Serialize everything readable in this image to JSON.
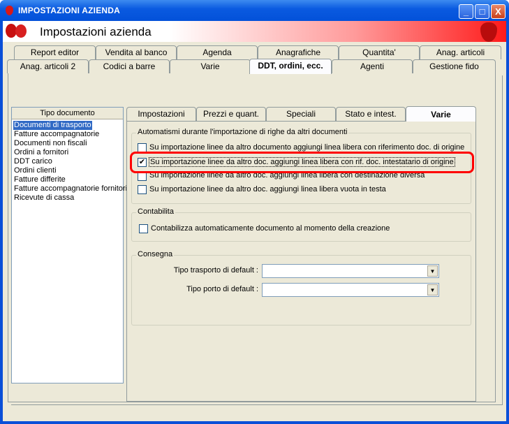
{
  "window": {
    "title": "IMPOSTAZIONI AZIENDA",
    "buttons": {
      "minimize": "_",
      "maximize": "□",
      "close": "X"
    }
  },
  "header": {
    "title": "Impostazioni azienda"
  },
  "outer_tabs": {
    "row1": [
      "Report editor",
      "Vendita al banco",
      "Agenda",
      "Anagrafiche",
      "Quantita'",
      "Anag. articoli"
    ],
    "row2": [
      "Anag. articoli 2",
      "Codici a barre",
      "Varie",
      "DDT, ordini, ecc.",
      "Agenti",
      "Gestione fido"
    ],
    "active": "DDT, ordini, ecc."
  },
  "doc_list": {
    "header": "Tipo documento",
    "items": [
      "Documenti di trasporto",
      "Fatture accompagnatorie",
      "Documenti non fiscali",
      "Ordini a fornitori",
      "DDT carico",
      "Ordini clienti",
      "Fatture differite",
      "Fatture accompagnatorie fornitori",
      "Ricevute di cassa"
    ],
    "selected": "Documenti di trasporto"
  },
  "inner_tabs": {
    "items": [
      "Impostazioni",
      "Prezzi e quant.",
      "Speciali",
      "Stato e intest.",
      "Varie"
    ],
    "active": "Varie"
  },
  "automatismi": {
    "label": "Automatismi durante l'importazione di righe da altri documenti",
    "options": [
      {
        "label": "Su importazione linee da altro documento aggiungi linea libera con riferimento doc. di origine",
        "checked": false
      },
      {
        "label": "Su importazione linee da altro doc. aggiungi linea libera con rif. doc. intestatario di origine",
        "checked": true
      },
      {
        "label": "Su importazione linee da altro doc. aggiungi linea libera con destinazione diversa",
        "checked": false
      },
      {
        "label": "Su importazione linee da altro doc. aggiungi linea libera vuota in testa",
        "checked": false
      }
    ]
  },
  "contabilita": {
    "label": "Contabilita",
    "option": {
      "label": "Contabilizza automaticamente documento al momento della creazione",
      "checked": false
    }
  },
  "consegna": {
    "label": "Consegna",
    "tipo_trasporto": {
      "label": "Tipo trasporto di default :",
      "value": ""
    },
    "tipo_porto": {
      "label": "Tipo porto di default :",
      "value": ""
    }
  },
  "colors": {
    "highlight": "#ff0000",
    "selection": "#316ac5",
    "titlebar": "#0a5ae0"
  }
}
